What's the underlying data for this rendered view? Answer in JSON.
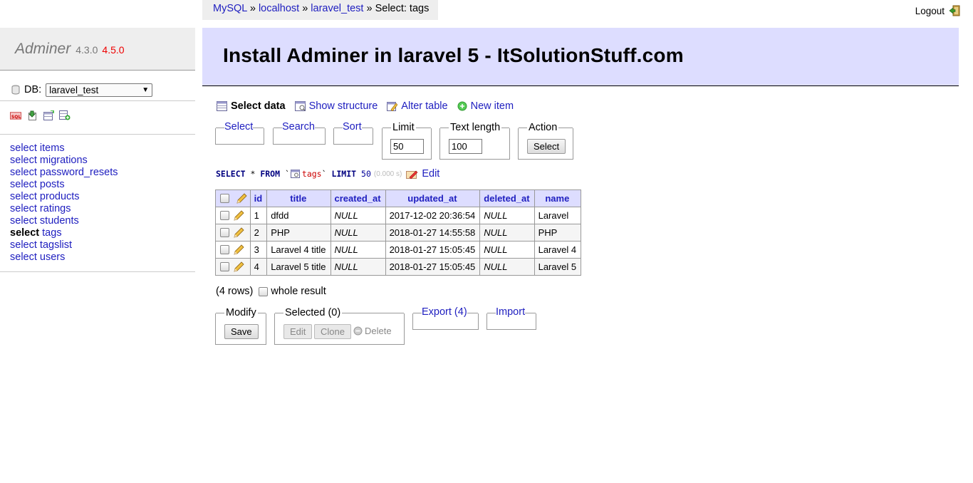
{
  "breadcrumb": {
    "system": "MySQL",
    "sep1": " » ",
    "server": "localhost",
    "sep2": " » ",
    "database": "laravel_test",
    "sep3": " » ",
    "current": "Select: tags"
  },
  "logout_label": "Logout",
  "sidebar": {
    "app_name": "Adminer",
    "version": "4.3.0",
    "new_version": "4.5.0",
    "db_label": "DB:",
    "db_value": "laravel_test",
    "tools": [
      "sql-command-icon",
      "import-icon",
      "create-table-icon",
      "dump-icon"
    ],
    "tables": [
      {
        "kw": "select",
        "name": "items",
        "active": false
      },
      {
        "kw": "select",
        "name": "migrations",
        "active": false
      },
      {
        "kw": "select",
        "name": "password_resets",
        "active": false
      },
      {
        "kw": "select",
        "name": "posts",
        "active": false
      },
      {
        "kw": "select",
        "name": "products",
        "active": false
      },
      {
        "kw": "select",
        "name": "ratings",
        "active": false
      },
      {
        "kw": "select",
        "name": "students",
        "active": false
      },
      {
        "kw": "select",
        "name": "tags",
        "active": true
      },
      {
        "kw": "select",
        "name": "tagslist",
        "active": false
      },
      {
        "kw": "select",
        "name": "users",
        "active": false
      }
    ]
  },
  "page_title": "Install Adminer in laravel 5 - ItSolutionStuff.com",
  "actions": {
    "select_data": "Select data",
    "show_structure": "Show structure",
    "alter_table": "Alter table",
    "new_item": "New item"
  },
  "filters": {
    "select": "Select",
    "search": "Search",
    "sort": "Sort",
    "limit_label": "Limit",
    "limit_value": "50",
    "text_length_label": "Text length",
    "text_length_value": "100",
    "action_label": "Action",
    "action_button": "Select"
  },
  "query": {
    "p1": "SELECT",
    "p2": " * ",
    "p3": "FROM",
    "p4": " `",
    "table": "tags",
    "p5": "` ",
    "p6": "LIMIT",
    "p7": " ",
    "limit": "50",
    "time": "(0.000 s)",
    "edit": "Edit"
  },
  "table": {
    "columns": [
      "id",
      "title",
      "created_at",
      "updated_at",
      "deleted_at",
      "name"
    ],
    "rows": [
      [
        "1",
        "dfdd",
        "NULL",
        "2017-12-02 20:36:54",
        "NULL",
        "Laravel"
      ],
      [
        "2",
        "PHP",
        "NULL",
        "2018-01-27 14:55:58",
        "NULL",
        "PHP"
      ],
      [
        "3",
        "Laravel 4 title",
        "NULL",
        "2018-01-27 15:05:45",
        "NULL",
        "Laravel 4"
      ],
      [
        "4",
        "Laravel 5 title",
        "NULL",
        "2018-01-27 15:05:45",
        "NULL",
        "Laravel 5"
      ]
    ]
  },
  "rows_count": "(4 rows)",
  "whole_result": "whole result",
  "bottom": {
    "modify_label": "Modify",
    "save": "Save",
    "selected_label": "Selected (0)",
    "edit": "Edit",
    "clone": "Clone",
    "delete": "Delete",
    "export": "Export (4)",
    "import": "Import"
  },
  "colors": {
    "link": "#2020c0",
    "header_bg": "#ddf",
    "sidebar_bg": "#eee",
    "new_version": "#e00"
  }
}
